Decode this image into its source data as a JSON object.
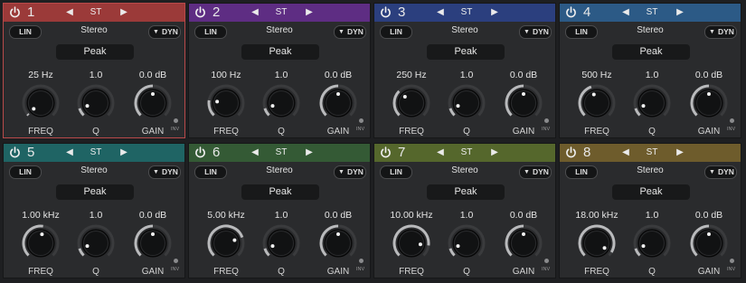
{
  "bands": [
    {
      "number": "1",
      "color": "#9b3a39",
      "selected": true,
      "stereo_mode": "ST",
      "lin_label": "LIN",
      "channel": "Stereo",
      "dyn_label": "DYN",
      "filter_type": "Peak",
      "freq_value": "25 Hz",
      "q_value": "1.0",
      "gain_value": "0.0 dB",
      "freq_label": "FREQ",
      "q_label": "Q",
      "gain_label": "GAIN",
      "inv_label": "INV",
      "freq_knob_level": 0.02,
      "q_knob_level": 0.1,
      "gain_knob_level": 0.5
    },
    {
      "number": "2",
      "color": "#5e2d83",
      "selected": false,
      "stereo_mode": "ST",
      "lin_label": "LIN",
      "channel": "Stereo",
      "dyn_label": "DYN",
      "filter_type": "Peak",
      "freq_value": "100 Hz",
      "q_value": "1.0",
      "gain_value": "0.0 dB",
      "freq_label": "FREQ",
      "q_label": "Q",
      "gain_label": "GAIN",
      "inv_label": "INV",
      "freq_knob_level": 0.2,
      "q_knob_level": 0.1,
      "gain_knob_level": 0.5
    },
    {
      "number": "3",
      "color": "#2b3f7e",
      "selected": false,
      "stereo_mode": "ST",
      "lin_label": "LIN",
      "channel": "Stereo",
      "dyn_label": "DYN",
      "filter_type": "Peak",
      "freq_value": "250 Hz",
      "q_value": "1.0",
      "gain_value": "0.0 dB",
      "freq_label": "FREQ",
      "q_label": "Q",
      "gain_label": "GAIN",
      "inv_label": "INV",
      "freq_knob_level": 0.33,
      "q_knob_level": 0.1,
      "gain_knob_level": 0.5
    },
    {
      "number": "4",
      "color": "#2c5a86",
      "selected": false,
      "stereo_mode": "ST",
      "lin_label": "LIN",
      "channel": "Stereo",
      "dyn_label": "DYN",
      "filter_type": "Peak",
      "freq_value": "500 Hz",
      "q_value": "1.0",
      "gain_value": "0.0 dB",
      "freq_label": "FREQ",
      "q_label": "Q",
      "gain_label": "GAIN",
      "inv_label": "INV",
      "freq_knob_level": 0.43,
      "q_knob_level": 0.1,
      "gain_knob_level": 0.5
    },
    {
      "number": "5",
      "color": "#1f6464",
      "selected": false,
      "stereo_mode": "ST",
      "lin_label": "LIN",
      "channel": "Stereo",
      "dyn_label": "DYN",
      "filter_type": "Peak",
      "freq_value": "1.00 kHz",
      "q_value": "1.0",
      "gain_value": "0.0 dB",
      "freq_label": "FREQ",
      "q_label": "Q",
      "gain_label": "GAIN",
      "inv_label": "INV",
      "freq_knob_level": 0.53,
      "q_knob_level": 0.1,
      "gain_knob_level": 0.5
    },
    {
      "number": "6",
      "color": "#345a35",
      "selected": false,
      "stereo_mode": "ST",
      "lin_label": "LIN",
      "channel": "Stereo",
      "dyn_label": "DYN",
      "filter_type": "Peak",
      "freq_value": "5.00 kHz",
      "q_value": "1.0",
      "gain_value": "0.0 dB",
      "freq_label": "FREQ",
      "q_label": "Q",
      "gain_label": "GAIN",
      "inv_label": "INV",
      "freq_knob_level": 0.76,
      "q_knob_level": 0.1,
      "gain_knob_level": 0.5
    },
    {
      "number": "7",
      "color": "#55672c",
      "selected": false,
      "stereo_mode": "ST",
      "lin_label": "LIN",
      "channel": "Stereo",
      "dyn_label": "DYN",
      "filter_type": "Peak",
      "freq_value": "10.00 kHz",
      "q_value": "1.0",
      "gain_value": "0.0 dB",
      "freq_label": "FREQ",
      "q_label": "Q",
      "gain_label": "GAIN",
      "inv_label": "INV",
      "freq_knob_level": 0.86,
      "q_knob_level": 0.1,
      "gain_knob_level": 0.5
    },
    {
      "number": "8",
      "color": "#6e5c2c",
      "selected": false,
      "stereo_mode": "ST",
      "lin_label": "LIN",
      "channel": "Stereo",
      "dyn_label": "DYN",
      "filter_type": "Peak",
      "freq_value": "18.00 kHz",
      "q_value": "1.0",
      "gain_value": "0.0 dB",
      "freq_label": "FREQ",
      "q_label": "Q",
      "gain_label": "GAIN",
      "inv_label": "INV",
      "freq_knob_level": 0.95,
      "q_knob_level": 0.1,
      "gain_knob_level": 0.5
    }
  ]
}
